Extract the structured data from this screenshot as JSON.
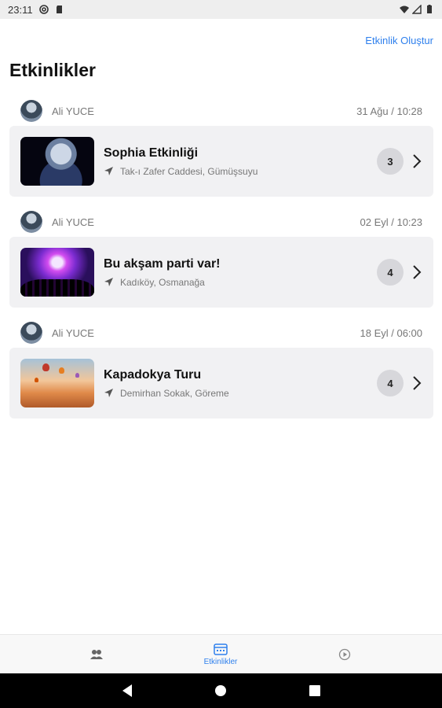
{
  "status_bar": {
    "time": "23:11",
    "icons": [
      "at-sign-icon",
      "sd-card-icon",
      "wifi-icon",
      "signal-icon",
      "battery-icon"
    ]
  },
  "header": {
    "create_label": "Etkinlik Oluştur",
    "title": "Etkinlikler"
  },
  "events": [
    {
      "author": "Ali YUCE",
      "date": "31 Ağu / 10:28",
      "title": "Sophia Etkinliği",
      "location": "Tak-ı Zafer Caddesi, Gümüşsuyu",
      "count": "3"
    },
    {
      "author": "Ali YUCE",
      "date": "02 Eyl / 10:23",
      "title": "Bu akşam parti var!",
      "location": "Kadıköy, Osmanağa",
      "count": "4"
    },
    {
      "author": "Ali YUCE",
      "date": "18 Eyl / 06:00",
      "title": "Kapadokya Turu",
      "location": "Demirhan Sokak, Göreme",
      "count": "4"
    }
  ],
  "tab_bar": {
    "tabs": [
      {
        "icon": "people-icon",
        "label": ""
      },
      {
        "icon": "calendar-icon",
        "label": "Etkinlikler"
      },
      {
        "icon": "play-circle-icon",
        "label": ""
      }
    ],
    "active_color": "#2f80ed"
  },
  "nav_bar": {
    "icons": [
      "back-icon",
      "home-icon",
      "recents-icon"
    ]
  }
}
